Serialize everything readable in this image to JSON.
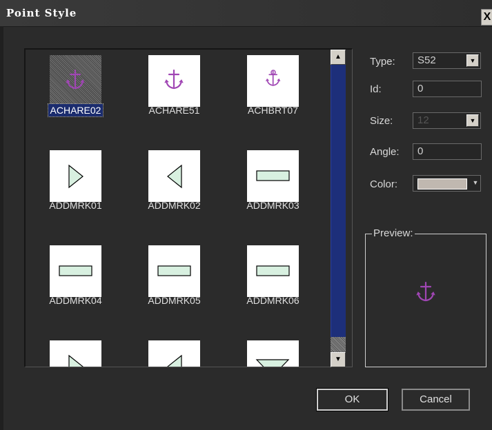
{
  "window": {
    "title": "Point Style",
    "close_label": "X"
  },
  "symbols": [
    {
      "name": "ACHARE02",
      "icon": "anchor-icon",
      "selected": true
    },
    {
      "name": "ACHARE51",
      "icon": "anchor-icon",
      "selected": false
    },
    {
      "name": "ACHBRT07",
      "icon": "anchor-berth-icon",
      "selected": false
    },
    {
      "name": "ADDMRK01",
      "icon": "triangle-right-icon",
      "selected": false
    },
    {
      "name": "ADDMRK02",
      "icon": "triangle-left-icon",
      "selected": false
    },
    {
      "name": "ADDMRK03",
      "icon": "rectangle-icon",
      "selected": false
    },
    {
      "name": "ADDMRK04",
      "icon": "rectangle-icon",
      "selected": false
    },
    {
      "name": "ADDMRK05",
      "icon": "rectangle-icon",
      "selected": false
    },
    {
      "name": "ADDMRK06",
      "icon": "rectangle-icon",
      "selected": false
    },
    {
      "name": "",
      "icon": "triangle-right-icon",
      "selected": false
    },
    {
      "name": "",
      "icon": "triangle-left-icon",
      "selected": false
    },
    {
      "name": "",
      "icon": "triangle-down-icon",
      "selected": false
    }
  ],
  "form": {
    "type_label": "Type:",
    "type_value": "S52",
    "id_label": "Id:",
    "id_value": "0",
    "size_label": "Size:",
    "size_value": "12",
    "angle_label": "Angle:",
    "angle_value": "0",
    "color_label": "Color:",
    "color_value": "#c0b8b0"
  },
  "preview": {
    "label": "Preview:",
    "icon": "anchor-icon"
  },
  "buttons": {
    "ok": "OK",
    "cancel": "Cancel"
  },
  "colors": {
    "symbol_magenta": "#a046b4",
    "symbol_fill": "#d8f0e0",
    "selection": "#1b2c6e"
  }
}
